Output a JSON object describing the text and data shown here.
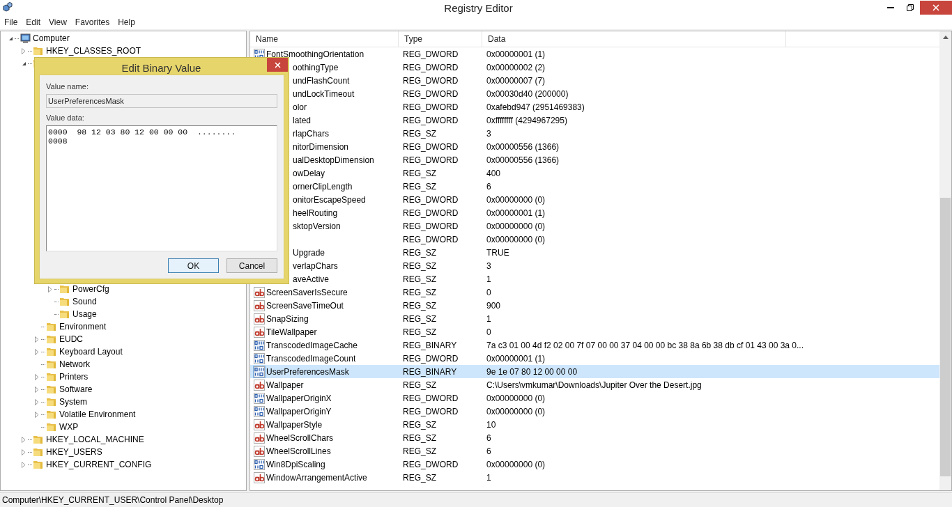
{
  "window": {
    "title": "Registry Editor"
  },
  "menu": [
    "File",
    "Edit",
    "View",
    "Favorites",
    "Help"
  ],
  "tree": [
    {
      "label": "Computer",
      "kind": "computer",
      "expanded": true,
      "children": [
        {
          "label": "HKEY_CLASSES_ROOT",
          "expanded": false
        },
        {
          "expanded": true,
          "children": [
            {
              "children": [
                {
                  "label": "PowerCfg",
                  "expanded": false
                },
                {
                  "label": "Sound"
                },
                {
                  "label": "Usage"
                }
              ]
            },
            {
              "label": "Environment"
            },
            {
              "label": "EUDC",
              "expanded": false
            },
            {
              "label": "Keyboard Layout",
              "expanded": false
            },
            {
              "label": "Network"
            },
            {
              "label": "Printers",
              "expanded": false
            },
            {
              "label": "Software",
              "expanded": false
            },
            {
              "label": "System",
              "expanded": false
            },
            {
              "label": "Volatile Environment",
              "expanded": false
            },
            {
              "label": "WXP"
            }
          ]
        },
        {
          "label": "HKEY_LOCAL_MACHINE",
          "expanded": false
        },
        {
          "label": "HKEY_USERS",
          "expanded": false
        },
        {
          "label": "HKEY_CURRENT_CONFIG",
          "expanded": false
        }
      ]
    }
  ],
  "table": {
    "columns": [
      "Name",
      "Type",
      "Data"
    ],
    "rows": [
      {
        "kind": "dword",
        "name": "FontSmoothingOrientation",
        "type": "REG_DWORD",
        "data": "0x00000001 (1)",
        "selected": false
      },
      {
        "name": "oothingType",
        "type": "REG_DWORD",
        "data": "0x00000002 (2)",
        "selected": false
      },
      {
        "name": "undFlashCount",
        "type": "REG_DWORD",
        "data": "0x00000007 (7)",
        "selected": false
      },
      {
        "name": "undLockTimeout",
        "type": "REG_DWORD",
        "data": "0x00030d40 (200000)",
        "selected": false
      },
      {
        "name": "olor",
        "type": "REG_DWORD",
        "data": "0xafebd947 (2951469383)",
        "selected": false
      },
      {
        "name": "lated",
        "type": "REG_DWORD",
        "data": "0xffffffff (4294967295)",
        "selected": false
      },
      {
        "name": "rlapChars",
        "type": "REG_SZ",
        "data": "3",
        "selected": false
      },
      {
        "name": "nitorDimension",
        "type": "REG_DWORD",
        "data": "0x00000556 (1366)",
        "selected": false
      },
      {
        "name": "ualDesktopDimension",
        "type": "REG_DWORD",
        "data": "0x00000556 (1366)",
        "selected": false
      },
      {
        "name": "owDelay",
        "type": "REG_SZ",
        "data": "400",
        "selected": false
      },
      {
        "name": "ornerClipLength",
        "type": "REG_SZ",
        "data": "6",
        "selected": false
      },
      {
        "name": "onitorEscapeSpeed",
        "type": "REG_DWORD",
        "data": "0x00000000 (0)",
        "selected": false
      },
      {
        "name": "heelRouting",
        "type": "REG_DWORD",
        "data": "0x00000001 (1)",
        "selected": false
      },
      {
        "name": "sktopVersion",
        "type": "REG_DWORD",
        "data": "0x00000000 (0)",
        "selected": false
      },
      {
        "type": "REG_DWORD",
        "data": "0x00000000 (0)",
        "selected": false
      },
      {
        "name": "Upgrade",
        "type": "REG_SZ",
        "data": "TRUE",
        "selected": false
      },
      {
        "name": "verlapChars",
        "type": "REG_SZ",
        "data": "3",
        "selected": false
      },
      {
        "name": "aveActive",
        "type": "REG_SZ",
        "data": "1",
        "selected": false
      },
      {
        "kind": "sz",
        "name": "ScreenSaverIsSecure",
        "type": "REG_SZ",
        "data": "0",
        "selected": false
      },
      {
        "kind": "sz",
        "name": "ScreenSaveTimeOut",
        "type": "REG_SZ",
        "data": "900",
        "selected": false
      },
      {
        "kind": "sz",
        "name": "SnapSizing",
        "type": "REG_SZ",
        "data": "1",
        "selected": false
      },
      {
        "kind": "sz",
        "name": "TileWallpaper",
        "type": "REG_SZ",
        "data": "0",
        "selected": false
      },
      {
        "kind": "binary",
        "name": "TranscodedImageCache",
        "type": "REG_BINARY",
        "data": "7a c3 01 00 4d f2 02 00 7f 07 00 00 37 04 00 00 bc 38 8a 6b 38 db cf 01 43 00 3a 0...",
        "selected": false
      },
      {
        "kind": "dword",
        "name": "TranscodedImageCount",
        "type": "REG_DWORD",
        "data": "0x00000001 (1)",
        "selected": false
      },
      {
        "kind": "binary",
        "name": "UserPreferencesMask",
        "type": "REG_BINARY",
        "data": "9e 1e 07 80 12 00 00 00",
        "selected": true
      },
      {
        "kind": "sz",
        "name": "Wallpaper",
        "type": "REG_SZ",
        "data": "C:\\Users\\vmkumar\\Downloads\\Jupiter Over the Desert.jpg",
        "selected": false
      },
      {
        "kind": "dword",
        "name": "WallpaperOriginX",
        "type": "REG_DWORD",
        "data": "0x00000000 (0)",
        "selected": false
      },
      {
        "kind": "dword",
        "name": "WallpaperOriginY",
        "type": "REG_DWORD",
        "data": "0x00000000 (0)",
        "selected": false
      },
      {
        "kind": "sz",
        "name": "WallpaperStyle",
        "type": "REG_SZ",
        "data": "10",
        "selected": false
      },
      {
        "kind": "sz",
        "name": "WheelScrollChars",
        "type": "REG_SZ",
        "data": "6",
        "selected": false
      },
      {
        "kind": "sz",
        "name": "WheelScrollLines",
        "type": "REG_SZ",
        "data": "6",
        "selected": false
      },
      {
        "kind": "dword",
        "name": "Win8DpiScaling",
        "type": "REG_DWORD",
        "data": "0x00000000 (0)",
        "selected": false
      },
      {
        "kind": "sz",
        "name": "WindowArrangementActive",
        "type": "REG_SZ",
        "data": "1",
        "selected": false
      }
    ]
  },
  "status_bar": "Computer\\HKEY_CURRENT_USER\\Control Panel\\Desktop",
  "dialog": {
    "title": "Edit Binary Value",
    "value_name_label": "Value name:",
    "value_name": "UserPreferencesMask",
    "value_data_label": "Value data:",
    "value_data_lines": [
      "0000  98 12 03 80 12 00 00 00  ........",
      "0008"
    ],
    "buttons": [
      {
        "label": "OK",
        "default": true
      },
      {
        "label": "Cancel",
        "default": false
      }
    ]
  }
}
